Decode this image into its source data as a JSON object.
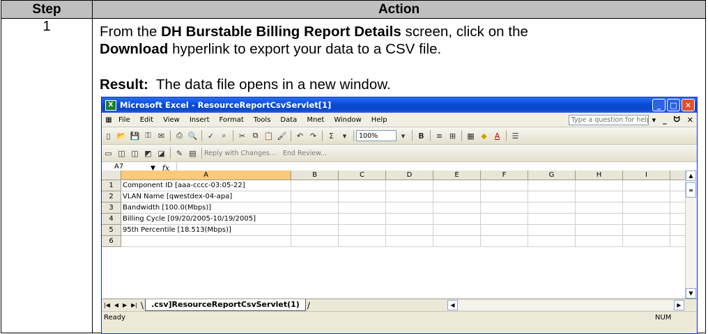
{
  "table": {
    "headers": {
      "step": "Step",
      "action": "Action"
    },
    "step_number": "1",
    "instruction": {
      "part1": "From the ",
      "screen_name": "DH Burstable Billing Report Details",
      "part2": " screen, click on the",
      "link_name": "Download",
      "part3": " hyperlink to export your data to a CSV file."
    },
    "result": {
      "label": "Result:",
      "text": "  The data file opens in a new window."
    }
  },
  "excel": {
    "title": "Microsoft Excel - ResourceReportCsvServlet[1]",
    "menu": [
      "File",
      "Edit",
      "View",
      "Insert",
      "Format",
      "Tools",
      "Data",
      "Mnet",
      "Window",
      "Help"
    ],
    "ask_placeholder": "Type a question for help",
    "zoom": "100%",
    "reviewing": {
      "reply": "Reply with Changes...",
      "end": "End Review..."
    },
    "name_box": "A7",
    "fx": "fx",
    "columns": [
      "A",
      "B",
      "C",
      "D",
      "E",
      "F",
      "G",
      "H",
      "I"
    ],
    "rows": [
      {
        "num": "1",
        "a": "Component ID [aaa-cccc-03:05-22]"
      },
      {
        "num": "2",
        "a": "VLAN Name [qwestdex-04-apa]"
      },
      {
        "num": "3",
        "a": "Bandwidth [100.0(Mbps)]"
      },
      {
        "num": "4",
        "a": "Billing Cycle [09/20/2005-10/19/2005]"
      },
      {
        "num": "5",
        "a": "95th Percentile [18.513(Mbps)]"
      },
      {
        "num": "6",
        "a": ""
      }
    ],
    "sheet_tab": ".csv]ResourceReportCsvServlet(1)",
    "status_left": "Ready",
    "status_num": "NUM"
  },
  "icons": [
    "excel-app-icon",
    "minimize-icon",
    "maximize-icon",
    "close-icon"
  ]
}
